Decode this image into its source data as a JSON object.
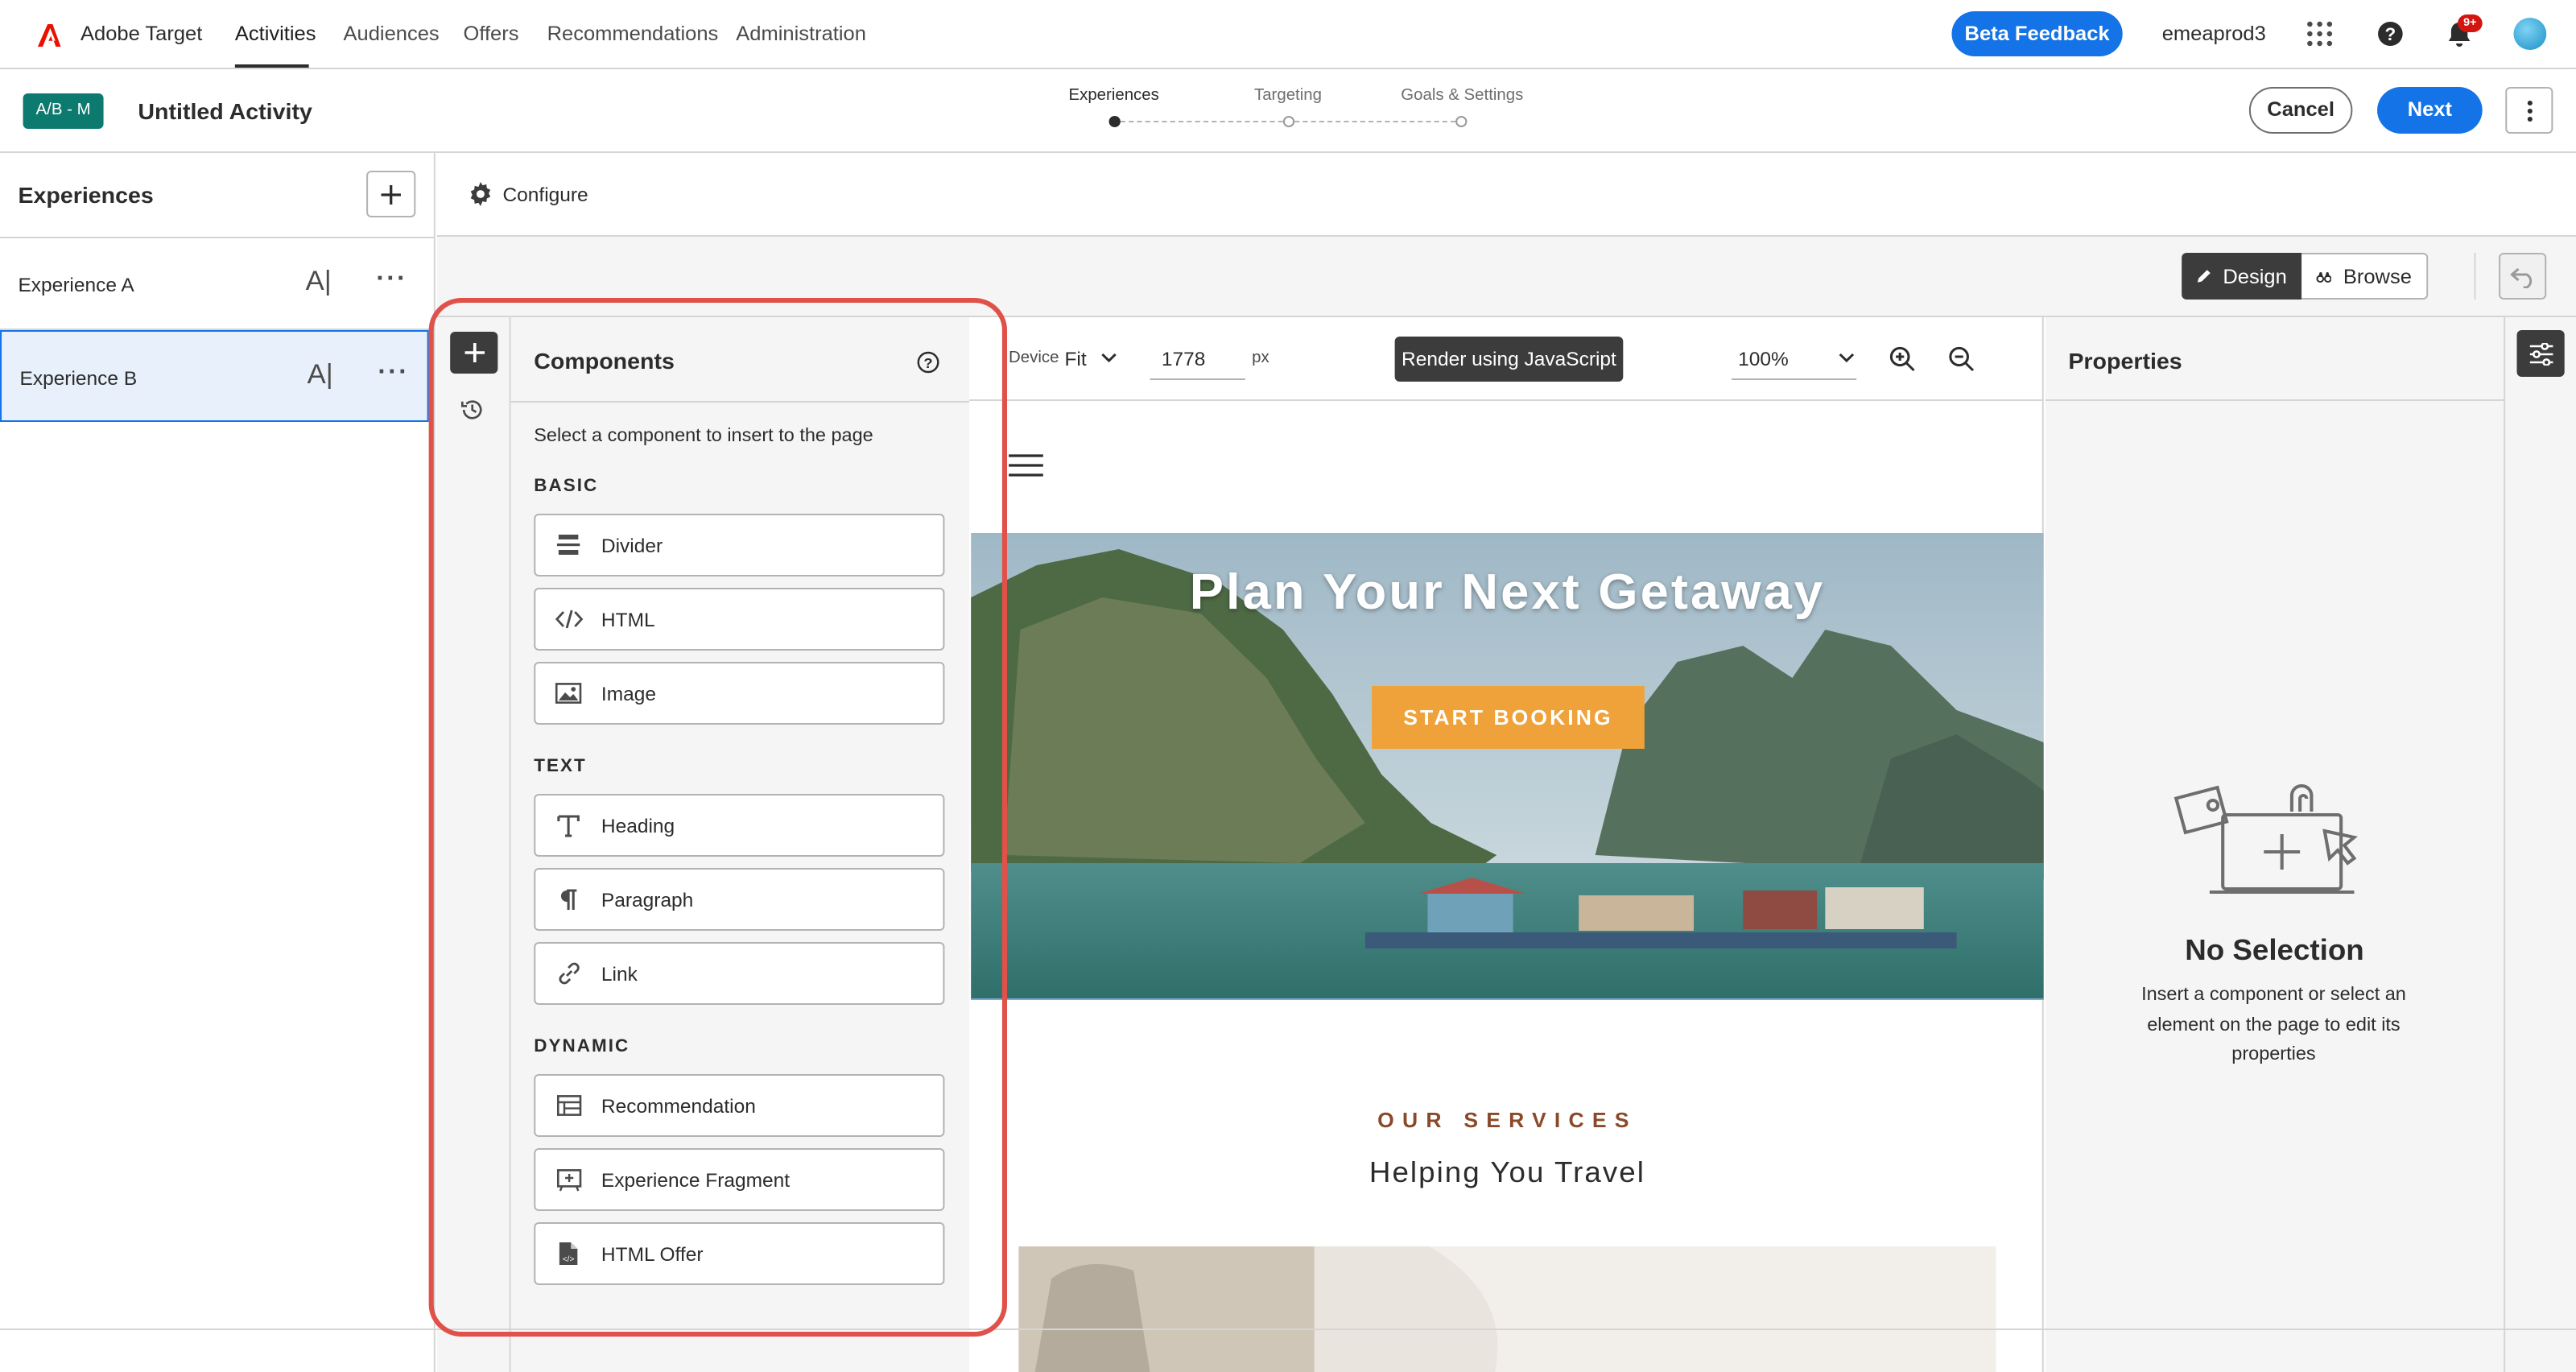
{
  "topnav": {
    "brand": "Adobe Target",
    "items": [
      "Activities",
      "Audiences",
      "Offers",
      "Recommendations",
      "Administration"
    ],
    "active": "Activities",
    "beta_label": "Beta Feedback",
    "tenant": "emeaprod3",
    "notification_count": "9+",
    "icons": [
      "apps-grid-icon",
      "help-icon",
      "bell-icon",
      "avatar"
    ]
  },
  "activity": {
    "tag": "A/B - M",
    "title": "Untitled Activity",
    "steps": [
      "Experiences",
      "Targeting",
      "Goals & Settings"
    ],
    "current_step": "Experiences",
    "cancel_label": "Cancel",
    "next_label": "Next"
  },
  "experiences": {
    "heading": "Experiences",
    "items": [
      {
        "label": "Experience A",
        "selected": false
      },
      {
        "label": "Experience B",
        "selected": true
      }
    ],
    "ai_label": "A|",
    "more_label": "···"
  },
  "configure": {
    "label": "Configure"
  },
  "mode": {
    "design_label": "Design",
    "browse_label": "Browse",
    "active": "Design"
  },
  "components": {
    "heading": "Components",
    "subtitle": "Select a component to insert to the page",
    "sections": [
      {
        "title": "BASIC",
        "items": [
          {
            "label": "Divider",
            "icon": "divider-icon"
          },
          {
            "label": "HTML",
            "icon": "code-icon"
          },
          {
            "label": "Image",
            "icon": "image-icon"
          }
        ]
      },
      {
        "title": "TEXT",
        "items": [
          {
            "label": "Heading",
            "icon": "heading-icon"
          },
          {
            "label": "Paragraph",
            "icon": "paragraph-icon"
          },
          {
            "label": "Link",
            "icon": "link-icon"
          }
        ]
      },
      {
        "title": "DYNAMIC",
        "items": [
          {
            "label": "Recommendation",
            "icon": "recommendation-icon"
          },
          {
            "label": "Experience Fragment",
            "icon": "fragment-icon"
          },
          {
            "label": "HTML Offer",
            "icon": "html-offer-icon"
          }
        ]
      }
    ]
  },
  "canvas_toolbar": {
    "device_label": "Device",
    "fit_label": "Fit",
    "width_value": "1778",
    "unit": "px",
    "render_label": "Render using JavaScript",
    "zoom": "100%"
  },
  "page": {
    "hero_title": "Plan Your Next Getaway",
    "cta": "START BOOKING",
    "services_eyebrow": "OUR SERVICES",
    "services_title": "Helping You Travel"
  },
  "properties": {
    "heading": "Properties",
    "empty_title": "No Selection",
    "empty_text": "Insert a component or select an element on the page to edit its properties"
  },
  "colors": {
    "accent": "#1473e6",
    "tag": "#0d7a6f",
    "cta": "#efa23a",
    "highlight": "#e0514a"
  }
}
